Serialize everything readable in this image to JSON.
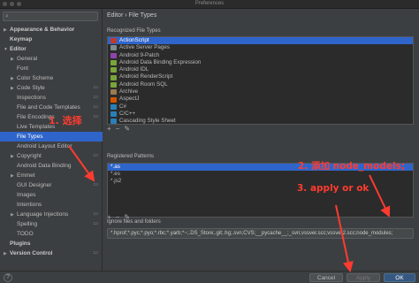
{
  "window": {
    "title": "Preferences"
  },
  "search": {
    "placeholder": ""
  },
  "sidebar": {
    "items": [
      {
        "label": "Appearance & Behavior",
        "arrow": "▶",
        "indent": 0,
        "bold": true
      },
      {
        "label": "Keymap",
        "arrow": "",
        "indent": 0,
        "bold": true
      },
      {
        "label": "Editor",
        "arrow": "▼",
        "indent": 0,
        "bold": true
      },
      {
        "label": "General",
        "arrow": "▶",
        "indent": 1
      },
      {
        "label": "Font",
        "arrow": "",
        "indent": 1
      },
      {
        "label": "Color Scheme",
        "arrow": "▶",
        "indent": 1
      },
      {
        "label": "Code Style",
        "arrow": "▶",
        "indent": 1,
        "page_icon": true
      },
      {
        "label": "Inspections",
        "arrow": "",
        "indent": 1,
        "page_icon": true
      },
      {
        "label": "File and Code Templates",
        "arrow": "",
        "indent": 1,
        "page_icon": true
      },
      {
        "label": "File Encodings",
        "arrow": "",
        "indent": 1,
        "page_icon": true
      },
      {
        "label": "Live Templates",
        "arrow": "",
        "indent": 1
      },
      {
        "label": "File Types",
        "arrow": "",
        "indent": 1,
        "selected": true
      },
      {
        "label": "Android Layout Editor",
        "arrow": "",
        "indent": 1
      },
      {
        "label": "Copyright",
        "arrow": "▶",
        "indent": 1,
        "page_icon": true
      },
      {
        "label": "Android Data Binding",
        "arrow": "",
        "indent": 1
      },
      {
        "label": "Emmet",
        "arrow": "▶",
        "indent": 1
      },
      {
        "label": "GUI Designer",
        "arrow": "",
        "indent": 1,
        "page_icon": true
      },
      {
        "label": "Images",
        "arrow": "",
        "indent": 1
      },
      {
        "label": "Intentions",
        "arrow": "",
        "indent": 1
      },
      {
        "label": "Language Injections",
        "arrow": "▶",
        "indent": 1,
        "page_icon": true
      },
      {
        "label": "Spelling",
        "arrow": "",
        "indent": 1,
        "page_icon": true
      },
      {
        "label": "TODO",
        "arrow": "",
        "indent": 1
      },
      {
        "label": "Plugins",
        "arrow": "",
        "indent": 0,
        "bold": true
      },
      {
        "label": "Version Control",
        "arrow": "▶",
        "indent": 0,
        "bold": true,
        "page_icon": true
      }
    ]
  },
  "main": {
    "breadcrumb": {
      "parent": "Editor",
      "separator": "›",
      "current": "File Types"
    },
    "recognized_label": "Recognized File Types",
    "file_types": [
      {
        "label": "ActionScript",
        "color": "#c0392b",
        "selected": true
      },
      {
        "label": "Active Server Pages",
        "color": "#7f8c8d"
      },
      {
        "label": "Android 9-Patch",
        "color": "#8e44ad"
      },
      {
        "label": "Android Data Binding Expression",
        "color": "#7aa53a"
      },
      {
        "label": "Android IDL",
        "color": "#7aa53a"
      },
      {
        "label": "Android RenderScript",
        "color": "#7aa53a"
      },
      {
        "label": "Android Room SQL",
        "color": "#7aa53a"
      },
      {
        "label": "Archive",
        "color": "#9a7b4f"
      },
      {
        "label": "AspectJ",
        "color": "#d35400"
      },
      {
        "label": "C#",
        "color": "#2980b9"
      },
      {
        "label": "C/C++",
        "color": "#2980b9"
      },
      {
        "label": "Cascading Style Sheet",
        "color": "#2980b9"
      }
    ],
    "types_toolbar": [
      "+",
      "−",
      "✎"
    ],
    "patterns_label": "Registered Patterns",
    "patterns": [
      {
        "label": "*.as",
        "selected": true
      },
      {
        "label": "*.es"
      },
      {
        "label": "*.js2"
      }
    ],
    "patterns_toolbar": [
      "+",
      "−",
      "✎"
    ],
    "ignore_label": "Ignore files and folders",
    "ignore_value": "*.hprof;*.pyc;*.pyo;*.rbc;*.yarb;*~;.DS_Store;.git;.hg;.svn;CVS;__pycache__;_svn;vssver.scc;vssver2.scc;node_modules;"
  },
  "footer": {
    "help": "?",
    "cancel": "Cancel",
    "apply": "Apply",
    "ok": "OK"
  },
  "annotations": {
    "step1": "1. 选择",
    "step2": "2. 添加 node_models;",
    "step3": "3. apply or ok",
    "color": "#ff3b30"
  }
}
